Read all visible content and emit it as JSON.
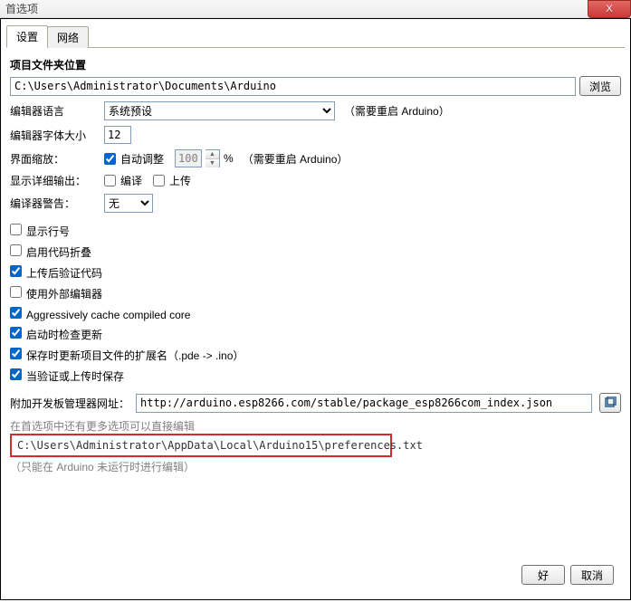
{
  "window": {
    "title": "首选项",
    "close": "X"
  },
  "tabs": {
    "settings": "设置",
    "network": "网络"
  },
  "sketchbook": {
    "title": "项目文件夹位置",
    "path": "C:\\Users\\Administrator\\Documents\\Arduino",
    "browse": "浏览"
  },
  "editorLanguage": {
    "label": "编辑器语言",
    "value": "系统预设",
    "hint": "（需要重启 Arduino）"
  },
  "editorFont": {
    "label": "编辑器字体大小",
    "value": "12"
  },
  "scale": {
    "label": "界面缩放：",
    "auto": "自动调整",
    "value": "100",
    "pct": "%",
    "hint": "（需要重启 Arduino）"
  },
  "verbose": {
    "label": "显示详细输出：",
    "compile": "编译",
    "upload": "上传"
  },
  "warnings": {
    "label": "编译器警告：",
    "value": "无"
  },
  "checks": {
    "linenumbers": "显示行号",
    "codefolding": "启用代码折叠",
    "verifyupload": "上传后验证代码",
    "externaleditor": "使用外部编辑器",
    "cachecore": "Aggressively cache compiled core",
    "checkupdates": "启动时检查更新",
    "updateext": "保存时更新项目文件的扩展名（.pde -> .ino）",
    "saveverify": "当验证或上传时保存"
  },
  "boardsurl": {
    "label": "附加开发板管理器网址：",
    "value": "http://arduino.esp8266.com/stable/package_esp8266com_index.json"
  },
  "prefs_note": "在首选项中还有更多选项可以直接编辑",
  "prefs_path": "C:\\Users\\Administrator\\AppData\\Local\\Arduino15\\preferences.txt",
  "prefs_hint": "（只能在 Arduino 未运行时进行编辑）",
  "buttons": {
    "ok": "好",
    "cancel": "取消"
  }
}
